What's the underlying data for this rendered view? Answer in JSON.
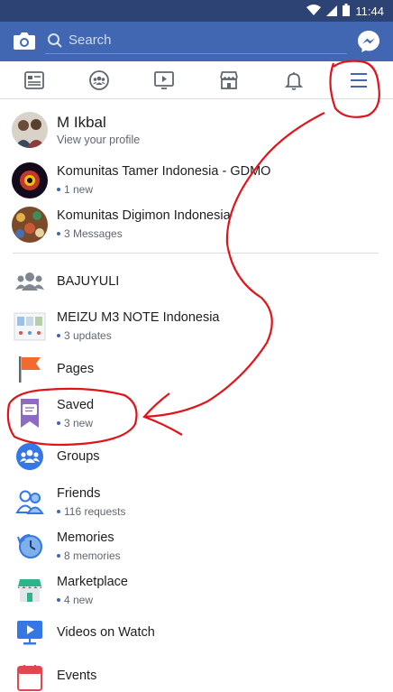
{
  "status_bar": {
    "time": "11:44"
  },
  "search": {
    "placeholder": "Search"
  },
  "tabs": [
    {
      "name": "news-feed"
    },
    {
      "name": "groups"
    },
    {
      "name": "watch"
    },
    {
      "name": "marketplace"
    },
    {
      "name": "notifications"
    },
    {
      "name": "menu",
      "active": true
    }
  ],
  "profile": {
    "name": "M Ikbal",
    "subtitle": "View your profile"
  },
  "groups": [
    {
      "title": "Komunitas Tamer Indonesia - GDMO",
      "sub": "1 new"
    },
    {
      "title": "Komunitas Digimon Indonesia",
      "sub": "3 Messages"
    }
  ],
  "shortcuts": [
    {
      "title": "BAJUYULI",
      "sub": ""
    },
    {
      "title": "MEIZU M3 NOTE Indonesia",
      "sub": "3 updates"
    },
    {
      "title": "Pages",
      "sub": ""
    },
    {
      "title": "Saved",
      "sub": "3 new"
    },
    {
      "title": "Groups",
      "sub": ""
    },
    {
      "title": "Friends",
      "sub": "116 requests"
    },
    {
      "title": "Memories",
      "sub": "8 memories"
    },
    {
      "title": "Marketplace",
      "sub": "4 new"
    },
    {
      "title": "Videos on Watch",
      "sub": ""
    },
    {
      "title": "Events",
      "sub": ""
    }
  ],
  "colors": {
    "brand": "#4267b2",
    "status_bar": "#2d4373",
    "annotation": "#e0141b"
  }
}
